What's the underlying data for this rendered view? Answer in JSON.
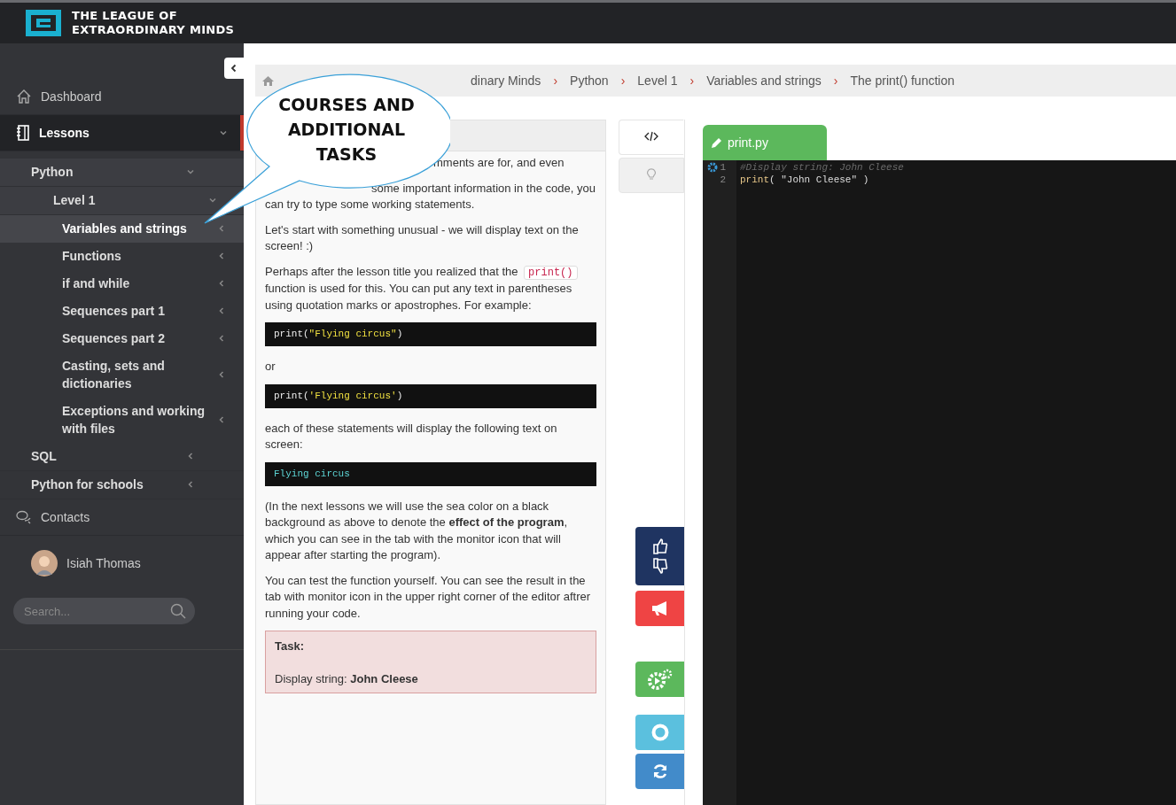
{
  "header": {
    "logo_line1": "THE LEAGUE OF",
    "logo_line2": "EXTRAORDINARY MINDS"
  },
  "sidebar": {
    "items": [
      {
        "label": "Dashboard",
        "selected": false
      },
      {
        "label": "Lessons",
        "selected": true,
        "expanded": true,
        "children": [
          {
            "label": "Python",
            "selected": false,
            "expanded": true,
            "children": [
              {
                "label": "Level 1",
                "selected": false,
                "expanded": true,
                "children": [
                  {
                    "label": "Variables and strings",
                    "selected": true,
                    "expanded": false
                  },
                  {
                    "label": "Functions",
                    "selected": false,
                    "expanded": false
                  },
                  {
                    "label": "if and while",
                    "selected": false,
                    "expanded": false
                  },
                  {
                    "label": "Sequences part 1",
                    "selected": false,
                    "expanded": false
                  },
                  {
                    "label": "Sequences part 2",
                    "selected": false,
                    "expanded": false
                  },
                  {
                    "label": "Casting, sets and dictionaries",
                    "selected": false,
                    "expanded": false
                  },
                  {
                    "label": "Exceptions and working with files",
                    "selected": false,
                    "expanded": false
                  }
                ]
              }
            ]
          },
          {
            "label": "SQL",
            "selected": false,
            "expanded": false
          },
          {
            "label": "Python for schools",
            "selected": false,
            "expanded": false
          }
        ]
      },
      {
        "label": "Contacts",
        "selected": false
      }
    ],
    "user": {
      "name": "Isiah Thomas"
    },
    "search": {
      "placeholder": "Search..."
    }
  },
  "breadcrumb": {
    "separator": "›",
    "items": [
      "dinary Minds",
      "Python",
      "Level 1",
      "Variables and strings",
      "The print() function"
    ]
  },
  "callout": {
    "lines": [
      "COURSES AND",
      "ADDITIONAL",
      "TASKS"
    ]
  },
  "lesson": {
    "blocks": [
      {
        "kind": "para",
        "parts": [
          {
            "kind": "text",
            "text": "mments are for, and even"
          }
        ]
      },
      {
        "kind": "para",
        "parts": [
          {
            "kind": "text",
            "text": "some important information in the code, you can try to type some working statements."
          }
        ]
      },
      {
        "kind": "para",
        "parts": [
          {
            "kind": "text",
            "text": "Let's start with something unusual - we will display text on the screen! :)"
          }
        ]
      },
      {
        "kind": "para",
        "parts": [
          {
            "kind": "text",
            "text": "Perhaps after the lesson title you realized that the"
          },
          {
            "kind": "code",
            "text": "print()"
          },
          {
            "kind": "text",
            "text": "function is used for this. You can put any text in parentheses using quotation marks or apostrophes. For example:"
          }
        ]
      },
      {
        "kind": "code",
        "tokens": [
          {
            "kind": "plain",
            "text": "print("
          },
          {
            "kind": "string",
            "text": "\"Flying circus\""
          },
          {
            "kind": "plain",
            "text": ")"
          }
        ]
      },
      {
        "kind": "para",
        "parts": [
          {
            "kind": "text",
            "text": "or"
          }
        ]
      },
      {
        "kind": "code",
        "tokens": [
          {
            "kind": "plain",
            "text": "print("
          },
          {
            "kind": "string",
            "text": "'Flying circus'"
          },
          {
            "kind": "plain",
            "text": ")"
          }
        ]
      },
      {
        "kind": "para",
        "parts": [
          {
            "kind": "text",
            "text": "each of these statements will display the following text on screen:"
          }
        ]
      },
      {
        "kind": "code",
        "tokens": [
          {
            "kind": "output",
            "text": "Flying circus"
          }
        ]
      },
      {
        "kind": "para",
        "parts": [
          {
            "kind": "text",
            "text": "(In the next lessons we will use the sea color on a black background as above to denote the **effect of the program**, which you can see in the tab with the monitor icon that will appear after starting the program)."
          }
        ]
      },
      {
        "kind": "para",
        "parts": [
          {
            "kind": "text",
            "text": "You can test the function yourself. You can see the result in the tab with monitor icon in the upper right corner of the editor aftrer running your code."
          }
        ]
      },
      {
        "kind": "task",
        "title": "Task:",
        "text": "Display string: **John Cleese**"
      }
    ]
  },
  "editor_tabs": [
    {
      "selected": true
    },
    {
      "selected": false
    }
  ],
  "side_buttons": [
    {
      "kind": "vote"
    },
    {
      "kind": "report"
    },
    {
      "kind": "run"
    },
    {
      "kind": "help"
    },
    {
      "kind": "reset"
    }
  ],
  "editor": {
    "filename": "print.py",
    "lines": [
      {
        "number": "1",
        "tokens": [
          {
            "kind": "comment",
            "text": "#Display string: John Cleese"
          }
        ]
      },
      {
        "number": "2",
        "tokens": [
          {
            "kind": "func",
            "text": "print"
          },
          {
            "kind": "plain",
            "text": "( \"John Cleese\" )"
          }
        ]
      }
    ]
  }
}
